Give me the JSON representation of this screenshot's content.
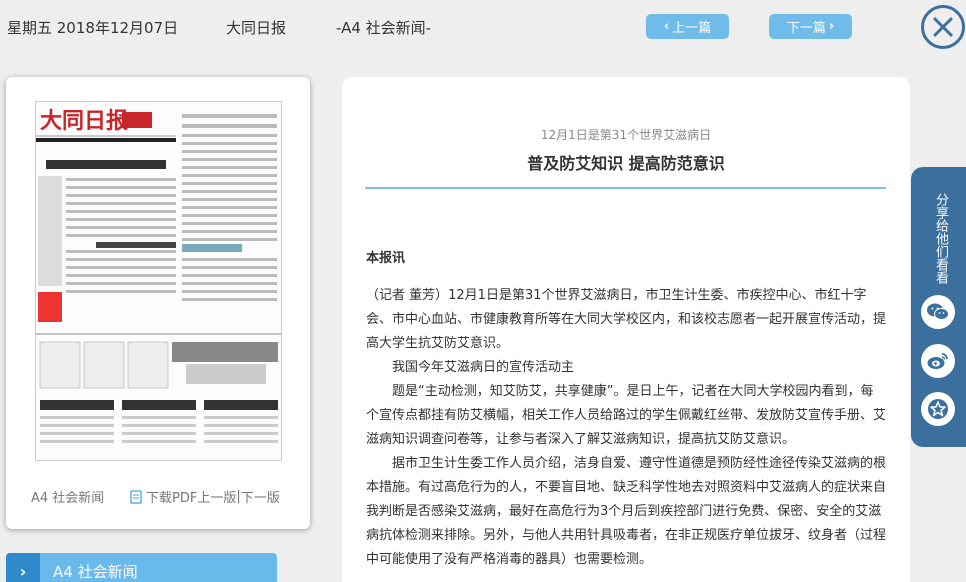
{
  "topbar": {
    "date": "星期五 2018年12月07日",
    "paper_name": "大同日报",
    "section": "-A4 社会新闻-",
    "prev_label": "上一篇",
    "next_label": "下一篇"
  },
  "thumbnail": {
    "masthead": "大同日报",
    "section_label": "A4 社会新闻",
    "pdf_label": "下载PDF",
    "prev_page": "上一版",
    "next_page": "下一版",
    "separator": "|"
  },
  "section_nav": {
    "label": "A4  社会新闻"
  },
  "article": {
    "subtitle": "12月1日是第31个世界艾滋病日",
    "title": "普及防艾知识 提高防范意识",
    "byline": "本报讯",
    "paragraphs": [
      "（记者 董芳）12月1日是第31个世界艾滋病日，市卫生计生委、市疾控中心、市红十字会、市中心血站、市健康教育所等在大同大学校区内，和该校志愿者一起开展宣传活动，提高大学生抗艾防艾意识。",
      "我国今年艾滋病日的宣传活动主",
      "题是“主动检测，知艾防艾，共享健康”。是日上午，记者在大同大学校园内看到，每个宣传点都挂有防艾横幅，相关工作人员给路过的学生佩戴红丝带、发放防艾宣传手册、艾滋病知识调查问卷等，让参与者深入了解艾滋病知识，提高抗艾防艾意识。",
      "据市卫生计生委工作人员介绍，洁身自爱、遵守性道德是预防经性途径传染艾滋病的根本措施。有过高危行为的人，不要盲目地、缺乏科学性地去对照资料中艾滋病人的症状来自我判断是否感染艾滋病，最好在高危行为3个月后到疾控部门进行免费、保密、安全的艾滋病抗体检测来排除。另外，与他人共用针具吸毒者，在非正规医疗单位拔牙、纹身者（过程中可能使用了没有严格消毒的器具）也需要检测。"
    ]
  },
  "share": {
    "label": "分享给他们看看",
    "icons": [
      "wechat-icon",
      "weibo-icon",
      "favorite-icon"
    ]
  },
  "colors": {
    "accent": "#6fbbe9",
    "dark_blue": "#3a6f9e",
    "rule": "#86bde3"
  }
}
